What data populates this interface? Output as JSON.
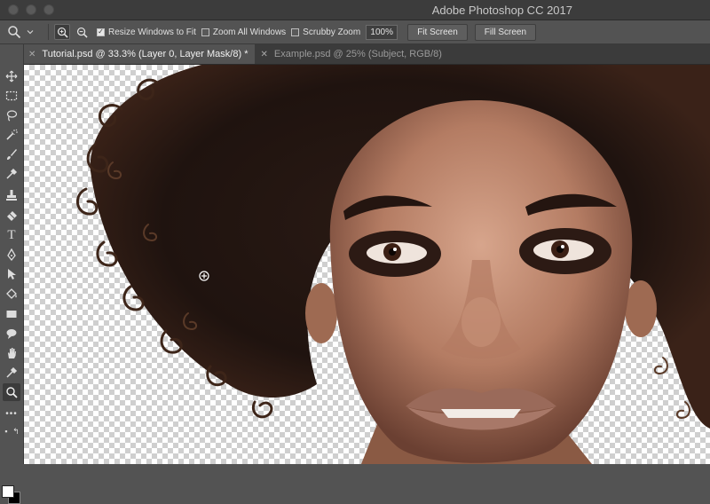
{
  "window": {
    "title": "Adobe Photoshop CC 2017"
  },
  "options_bar": {
    "resize_windows_label": "Resize Windows to Fit",
    "resize_windows_checked": true,
    "zoom_all_label": "Zoom All Windows",
    "zoom_all_checked": false,
    "scrubby_zoom_label": "Scrubby Zoom",
    "scrubby_zoom_checked": false,
    "zoom_value": "100%",
    "fit_screen_label": "Fit Screen",
    "fill_screen_label": "Fill Screen"
  },
  "tabs": [
    {
      "label": "Tutorial.psd @ 33.3% (Layer 0, Layer Mask/8) *",
      "active": true
    },
    {
      "label": "Example.psd @ 25% (Subject, RGB/8)",
      "active": false
    }
  ],
  "tools": [
    "move-tool",
    "marquee-tool",
    "lasso-tool",
    "magic-wand-tool",
    "crop-tool",
    "eyedropper-tool",
    "brush-tool",
    "clone-stamp-tool",
    "eraser-tool",
    "type-tool",
    "pen-tool",
    "path-selection-tool",
    "paint-bucket-tool",
    "rectangle-tool",
    "hand-tool",
    "zoom-tool",
    "more-tools"
  ],
  "colors": {
    "foreground": "#ffffff",
    "background": "#000000",
    "panel": "#535353",
    "titlebar": "#3c3c3c"
  },
  "canvas": {
    "content": "portrait-photo"
  }
}
